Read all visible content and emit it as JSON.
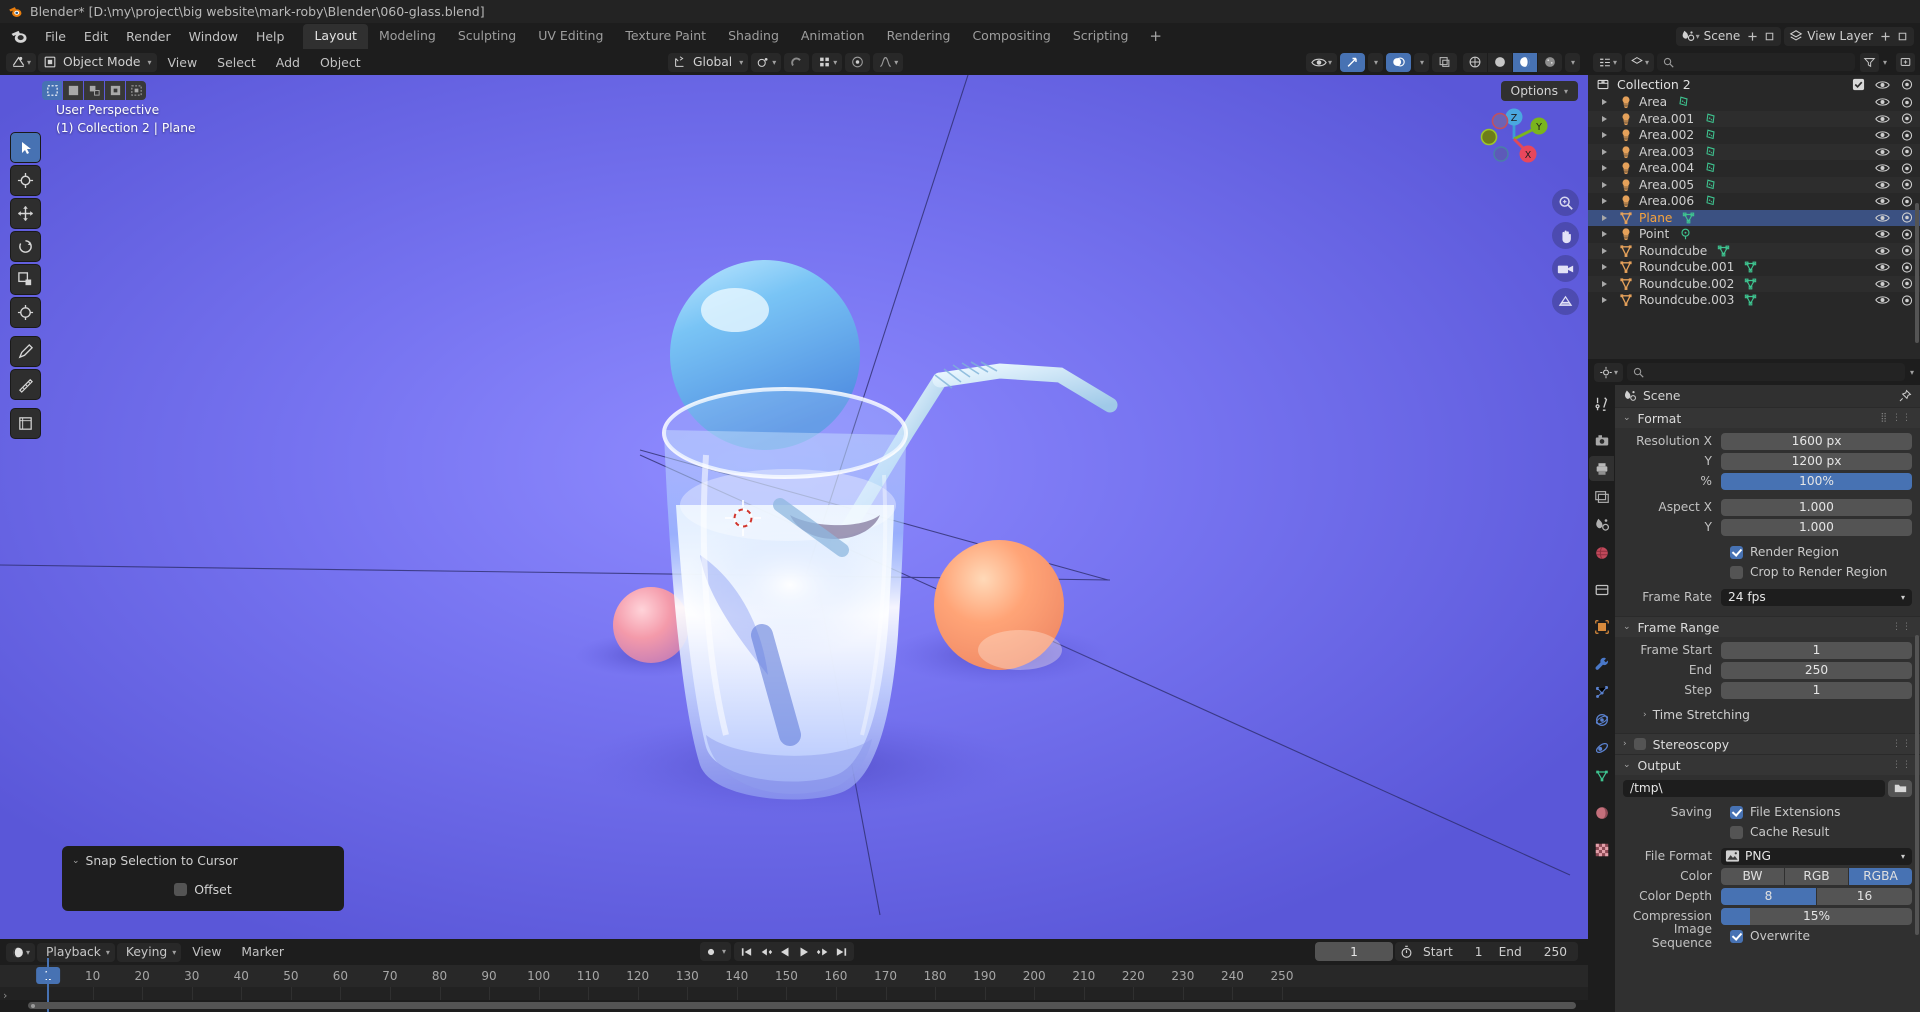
{
  "window": {
    "title": "Blender* [D:\\my\\project\\big website\\mark-roby\\Blender\\060-glass.blend]"
  },
  "topbar": {
    "menus": [
      "File",
      "Edit",
      "Render",
      "Window",
      "Help"
    ],
    "workspaces": [
      {
        "label": "Layout",
        "active": true
      },
      {
        "label": "Modeling",
        "active": false
      },
      {
        "label": "Sculpting",
        "active": false
      },
      {
        "label": "UV Editing",
        "active": false
      },
      {
        "label": "Texture Paint",
        "active": false
      },
      {
        "label": "Shading",
        "active": false
      },
      {
        "label": "Animation",
        "active": false
      },
      {
        "label": "Rendering",
        "active": false
      },
      {
        "label": "Compositing",
        "active": false
      },
      {
        "label": "Scripting",
        "active": false
      }
    ],
    "add_workspace": "+",
    "scene_name": "Scene",
    "view_layer_name": "View Layer"
  },
  "viewport": {
    "mode": "Object Mode",
    "menus": [
      "View",
      "Select",
      "Add",
      "Object"
    ],
    "transform_orientation": "Global",
    "options_label": "Options",
    "overlay_line1": "User Perspective",
    "overlay_line2": "(1) Collection 2 | Plane",
    "gizmo_axes": [
      "X",
      "Y",
      "Z"
    ],
    "operator_panel": {
      "title": "Snap Selection to Cursor",
      "offset_label": "Offset",
      "offset_checked": false
    }
  },
  "outliner": {
    "collection": "Collection 2",
    "items": [
      {
        "name": "Area",
        "type": "light",
        "data": "light-data",
        "selected": false
      },
      {
        "name": "Area.001",
        "type": "light",
        "data": "light-data",
        "selected": false
      },
      {
        "name": "Area.002",
        "type": "light",
        "data": "light-data",
        "selected": false
      },
      {
        "name": "Area.003",
        "type": "light",
        "data": "light-data",
        "selected": false
      },
      {
        "name": "Area.004",
        "type": "light",
        "data": "light-data",
        "selected": false
      },
      {
        "name": "Area.005",
        "type": "light",
        "data": "light-data",
        "selected": false
      },
      {
        "name": "Area.006",
        "type": "light",
        "data": "light-data",
        "selected": false
      },
      {
        "name": "Plane",
        "type": "mesh",
        "data": "mesh-data",
        "selected": true
      },
      {
        "name": "Point",
        "type": "light",
        "data": "point-light-data",
        "selected": false
      },
      {
        "name": "Roundcube",
        "type": "mesh",
        "data": "mesh-data",
        "selected": false
      },
      {
        "name": "Roundcube.001",
        "type": "mesh",
        "data": "mesh-data",
        "selected": false
      },
      {
        "name": "Roundcube.002",
        "type": "mesh",
        "data": "mesh-data",
        "selected": false
      },
      {
        "name": "Roundcube.003",
        "type": "mesh",
        "data": "mesh-data",
        "selected": false
      }
    ]
  },
  "properties": {
    "breadcrumb": "Scene",
    "tabs": [
      "tool-icon",
      "render-icon",
      "output-icon",
      "view-layer-icon",
      "scene-icon",
      "world-icon",
      "collection-icon",
      "object-icon",
      "modifier-icon",
      "particles-icon",
      "physics-icon",
      "constraints-icon",
      "data-icon",
      "material-icon",
      "texture-icon"
    ],
    "active_tab": "output-icon",
    "format": {
      "title": "Format",
      "resolution_x_label": "Resolution X",
      "resolution_x": "1600 px",
      "resolution_y_label": "Y",
      "resolution_y": "1200 px",
      "percent_label": "%",
      "percent": "100%",
      "aspect_x_label": "Aspect X",
      "aspect_x": "1.000",
      "aspect_y_label": "Y",
      "aspect_y": "1.000",
      "render_region_label": "Render Region",
      "render_region_checked": true,
      "crop_label": "Crop to Render Region",
      "crop_checked": false,
      "frame_rate_label": "Frame Rate",
      "frame_rate": "24 fps"
    },
    "frame_range": {
      "title": "Frame Range",
      "start_label": "Frame Start",
      "start": "1",
      "end_label": "End",
      "end": "250",
      "step_label": "Step",
      "step": "1",
      "time_stretching": "Time Stretching"
    },
    "stereoscopy": {
      "title": "Stereoscopy",
      "checked": false
    },
    "output": {
      "title": "Output",
      "path": "/tmp\\",
      "saving_label": "Saving",
      "file_extensions_label": "File Extensions",
      "file_extensions_checked": true,
      "cache_result_label": "Cache Result",
      "cache_result_checked": false,
      "file_format_label": "File Format",
      "file_format": "PNG",
      "color_label": "Color",
      "color_options": [
        "BW",
        "RGB",
        "RGBA"
      ],
      "color_selected": "RGBA",
      "color_depth_label": "Color Depth",
      "color_depth_options": [
        "8",
        "16"
      ],
      "color_depth_selected": "8",
      "compression_label": "Compression",
      "compression": "15%",
      "compression_pct": 15,
      "image_sequence_label": "Image Sequence",
      "overwrite_label": "Overwrite",
      "overwrite_checked": true
    }
  },
  "timeline": {
    "menus": [
      "Playback",
      "Keying",
      "View",
      "Marker"
    ],
    "current_frame": "1",
    "start_label": "Start",
    "start": "1",
    "end_label": "End",
    "end": "250",
    "ticks": [
      10,
      20,
      30,
      40,
      50,
      60,
      70,
      80,
      90,
      100,
      110,
      120,
      130,
      140,
      150,
      160,
      170,
      180,
      190,
      200,
      210,
      220,
      230,
      240,
      250
    ],
    "playhead_frame": "1"
  },
  "colors": {
    "accent_blue": "#4772b3",
    "panel_bg": "#303030",
    "editor_bg": "#282828",
    "header_bg": "#1d1d1d",
    "viewport_bg": "#6b68e8",
    "select_orange": "#f6a33c"
  }
}
